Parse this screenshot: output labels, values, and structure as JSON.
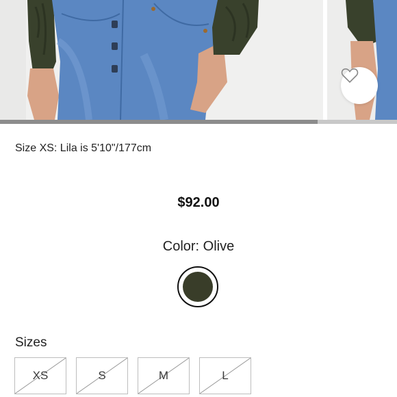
{
  "gallery": {
    "image_count": 3,
    "active_index": 1,
    "progress": 0.8,
    "favorite_icon": "heart-outline-icon",
    "colors": {
      "jeans": "#5b87c2",
      "sleeve": "#39412c",
      "skin": "#d8a386",
      "background": "#f0f0ef"
    }
  },
  "product": {
    "model_size_note": "Size XS: Lila is 5'10\"/177cm",
    "price": "$92.00",
    "color_label": "Color: Olive",
    "swatch": {
      "name": "Olive",
      "hex": "#393d29",
      "selected": true
    }
  },
  "sizes": {
    "heading": "Sizes",
    "options": [
      {
        "label": "XS",
        "available": false
      },
      {
        "label": "S",
        "available": false
      },
      {
        "label": "M",
        "available": false
      },
      {
        "label": "L",
        "available": false
      }
    ]
  }
}
